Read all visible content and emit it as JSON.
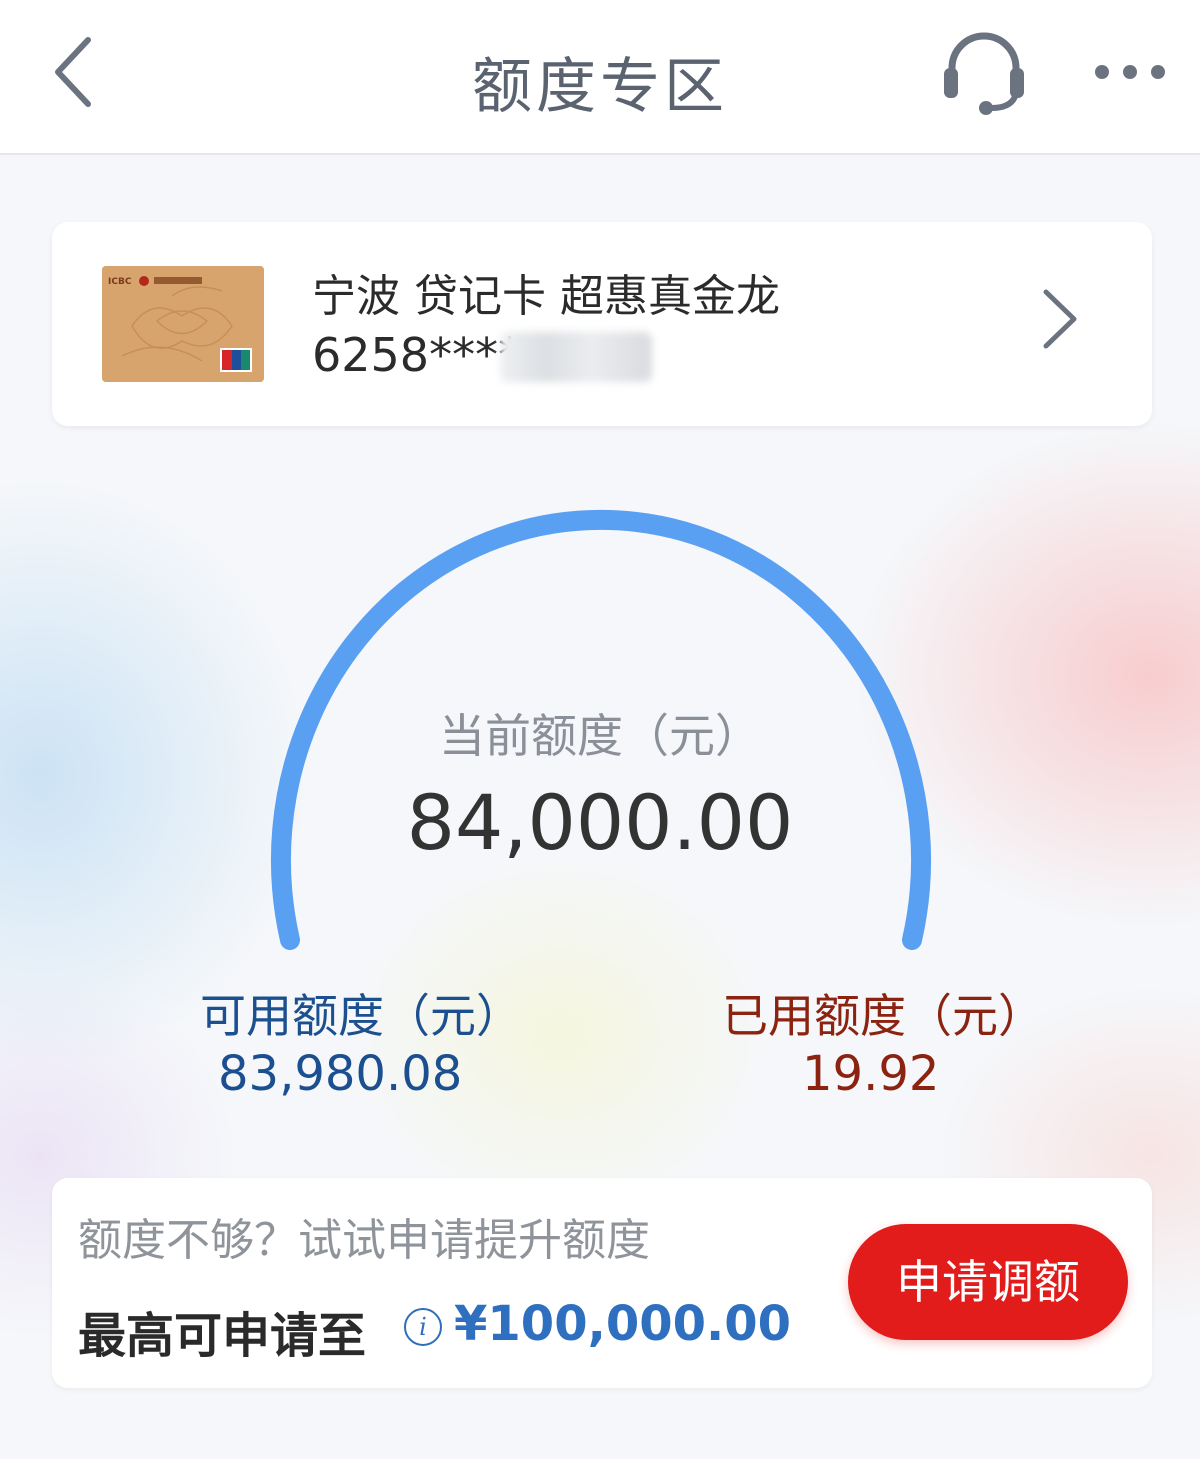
{
  "header": {
    "title": "额度专区"
  },
  "card": {
    "name": "宁波 贷记卡 超惠真金龙",
    "number_masked": "6258****"
  },
  "gauge": {
    "current_label": "当前额度（元）",
    "current_value": "84,000.00",
    "available_label": "可用额度（元）",
    "available_value": "83,980.08",
    "used_label": "已用额度（元）",
    "used_value": "19.92",
    "used_fraction": 0.000237
  },
  "raise": {
    "hint": "额度不够？试试申请提升额度",
    "max_label": "最高可申请至",
    "max_amount": "¥100,000.00",
    "button_label": "申请调额"
  },
  "colors": {
    "gauge_arc": "#5aa0f2",
    "available_text": "#1b4f8f",
    "used_text": "#8b2310",
    "button": "#e21b1b",
    "max_amount": "#2f6fc0"
  },
  "icons": {
    "back": "chevron-left-icon",
    "service": "headset-icon",
    "more": "more-dots-icon",
    "card_next": "chevron-right-icon",
    "info": "info-icon"
  }
}
